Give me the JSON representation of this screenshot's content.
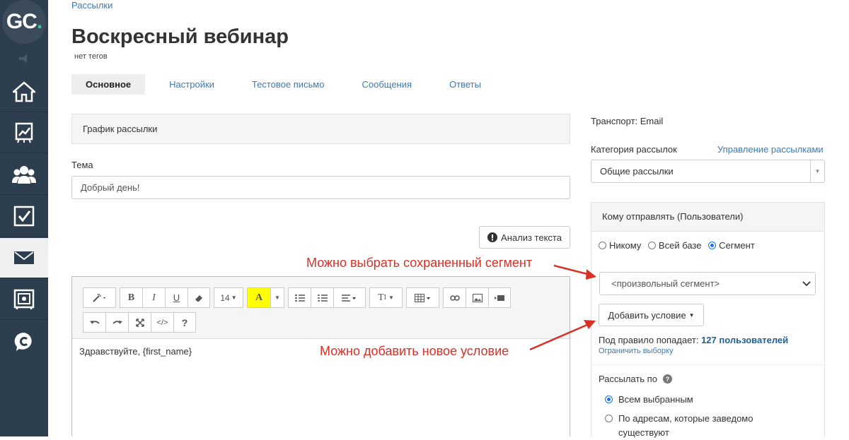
{
  "sidebar": {
    "logo_text": "GC",
    "logo_dot": ".",
    "items": [
      {
        "name": "home-icon"
      },
      {
        "name": "chart-icon"
      },
      {
        "name": "users-icon"
      },
      {
        "name": "checkbox-icon"
      },
      {
        "name": "mail-icon",
        "active": true
      },
      {
        "name": "safe-icon"
      },
      {
        "name": "chat-icon"
      }
    ]
  },
  "breadcrumb": "Рассылки",
  "page_title": "Воскресный вебинар",
  "tags": "нет тегов",
  "tabs": [
    "Основное",
    "Настройки",
    "Тестовое письмо",
    "Сообщения",
    "Ответы"
  ],
  "schedule_panel": "График рассылки",
  "subject": {
    "label": "Тема",
    "value": "Добрый день!"
  },
  "analyze_button": "Анализ текста",
  "editor": {
    "font_size": "14",
    "body": "Здравствуйте, {first_name}"
  },
  "transport": "Транспорт: Email",
  "category": {
    "label": "Категория рассылок",
    "manage_link": "Управление рассылками",
    "value": "Общие рассылки"
  },
  "recipients": {
    "title": "Кому отправлять (Пользователи)",
    "options": [
      "Никому",
      "Всей базе",
      "Сегмент"
    ],
    "selected": "Сегмент",
    "segment_value": "<произвольный сегмент>",
    "add_condition": "Добавить условие",
    "matches_prefix": "Под правило попадает:",
    "matches_count": "127 пользователей",
    "limit_link": "Ограничить выборку"
  },
  "send_by": {
    "label": "Рассылать по",
    "options": [
      "Всем выбранным",
      "По адресам, которые заведомо существуют"
    ],
    "selected": "Всем выбранным"
  },
  "annotations": {
    "segment_note": "Можно выбрать сохраненный сегмент",
    "condition_note": "Можно добавить новое условие",
    "color": "#d93025"
  }
}
